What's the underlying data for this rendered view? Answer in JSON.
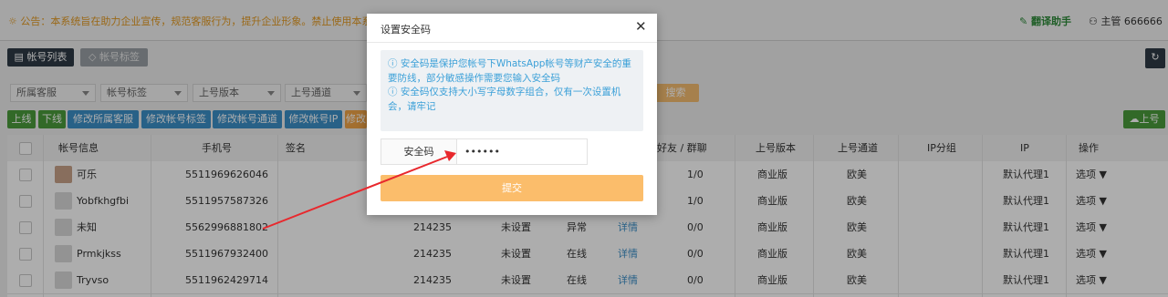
{
  "notice": {
    "text": "☼ 公告：本系统旨在助力企业宣传，规范客服行为，提升企业形象。禁止使用本系统从事违法活动，一经发现将立即封号处理！",
    "translate": "翻译助手",
    "user": "主管 666666"
  },
  "tabs": {
    "account_list": "帐号列表",
    "account_tags": "帐号标签"
  },
  "filters": [
    "所属客服",
    "帐号标签",
    "上号版本",
    "上号通道"
  ],
  "search_label": "搜索",
  "actions": [
    "上线",
    "下线",
    "修改所属客服",
    "修改帐号标签",
    "修改帐号通道",
    "修改帐号IP",
    "修改"
  ],
  "upload_label": "上号",
  "table": {
    "headers": [
      "帐号信息",
      "手机号",
      "签名",
      "好友 / 群聊",
      "上号版本",
      "上号通道",
      "IP分组",
      "IP",
      "操作"
    ],
    "rows": [
      {
        "name": "可乐",
        "phone": "5511969626046",
        "col5": "",
        "col6": "",
        "status": "",
        "detail": "",
        "friends": "1/0",
        "version": "商业版",
        "channel": "欧美",
        "ip": "默认代理1",
        "op": "选项"
      },
      {
        "name": "Yobfkhgfbi",
        "phone": "5511957587326",
        "col5": "",
        "col6": "",
        "status": "",
        "detail": "",
        "friends": "1/0",
        "version": "商业版",
        "channel": "欧美",
        "ip": "默认代理1",
        "op": "选项"
      },
      {
        "name": "未知",
        "phone": "5562996881802",
        "col5": "214235",
        "col6": "未设置",
        "status": "异常",
        "detail": "详情",
        "friends": "0/0",
        "version": "商业版",
        "channel": "欧美",
        "ip": "默认代理1",
        "op": "选项"
      },
      {
        "name": "Prmkjkss",
        "phone": "5511967932400",
        "col5": "214235",
        "col6": "未设置",
        "status": "在线",
        "detail": "详情",
        "friends": "0/0",
        "version": "商业版",
        "channel": "欧美",
        "ip": "默认代理1",
        "op": "选项"
      },
      {
        "name": "Tryvso",
        "phone": "5511962429714",
        "col5": "214235",
        "col6": "未设置",
        "status": "在线",
        "detail": "详情",
        "friends": "0/0",
        "version": "商业版",
        "channel": "欧美",
        "ip": "默认代理1",
        "op": "选项"
      }
    ]
  },
  "modal": {
    "title": "设置安全码",
    "close": "✕",
    "info_line1": "ⓘ 安全码是保护您帐号下WhatsApp帐号等财产安全的重要防线，部分敏感操作需要您输入安全码",
    "info_line2": "ⓘ 安全码仅支持大小写字母数字组合，仅有一次设置机会，请牢记",
    "field_label": "安全码",
    "field_value": "••••••",
    "submit": "提交"
  }
}
